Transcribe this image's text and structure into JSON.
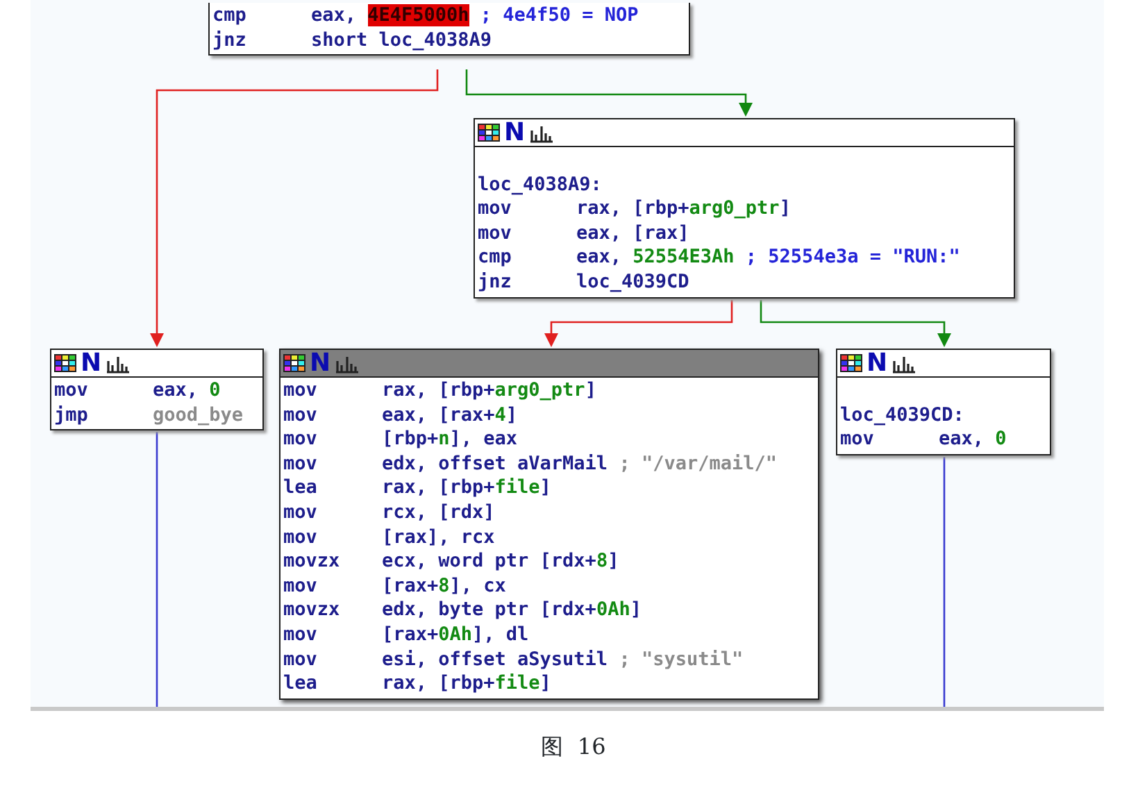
{
  "graph": {
    "nodes": [
      {
        "lines": [
          {
            "mnemonic": "cmp",
            "operand": [
              {
                "kind": "text",
                "text": "eax, "
              },
              {
                "kind": "highlight",
                "text": "4E4F5000h"
              }
            ],
            "comment": [
              {
                "kind": "comment",
                "text": "; 4e4f50 = NOP"
              }
            ]
          },
          {
            "mnemonic": "jnz",
            "operand": [
              {
                "kind": "text",
                "text": "short loc_4038A9"
              }
            ]
          }
        ]
      },
      {
        "selected": false,
        "header_mark": "N",
        "label": "loc_4038A9:",
        "lines": [
          {
            "mnemonic": "mov",
            "operand": [
              {
                "kind": "text",
                "text": "rax, [rbp+"
              },
              {
                "kind": "num",
                "text": "arg0_ptr"
              },
              {
                "kind": "text",
                "text": "]"
              }
            ]
          },
          {
            "mnemonic": "mov",
            "operand": [
              {
                "kind": "text",
                "text": "eax, [rax]"
              }
            ]
          },
          {
            "mnemonic": "cmp",
            "operand": [
              {
                "kind": "text",
                "text": "eax, "
              },
              {
                "kind": "num",
                "text": "52554E3Ah"
              }
            ],
            "comment": [
              {
                "kind": "comment",
                "text": "; 52554e3a = \"RUN:\""
              }
            ]
          },
          {
            "mnemonic": "jnz",
            "operand": [
              {
                "kind": "text",
                "text": "loc_4039CD"
              }
            ]
          }
        ]
      },
      {
        "selected": false,
        "header_mark": "N",
        "lines": [
          {
            "mnemonic": "mov",
            "operand": [
              {
                "kind": "text",
                "text": "eax, "
              },
              {
                "kind": "num",
                "text": "0"
              }
            ]
          },
          {
            "mnemonic": "jmp",
            "operand": [
              {
                "kind": "dim",
                "text": "good_bye"
              }
            ]
          }
        ]
      },
      {
        "selected": true,
        "header_mark": "N",
        "lines": [
          {
            "mnemonic": "mov",
            "operand": [
              {
                "kind": "text",
                "text": "rax, [rbp+"
              },
              {
                "kind": "num",
                "text": "arg0_ptr"
              },
              {
                "kind": "text",
                "text": "]"
              }
            ]
          },
          {
            "mnemonic": "mov",
            "operand": [
              {
                "kind": "text",
                "text": "eax, [rax+"
              },
              {
                "kind": "num",
                "text": "4"
              },
              {
                "kind": "text",
                "text": "]"
              }
            ]
          },
          {
            "mnemonic": "mov",
            "operand": [
              {
                "kind": "text",
                "text": "[rbp+"
              },
              {
                "kind": "num",
                "text": "n"
              },
              {
                "kind": "text",
                "text": "], eax"
              }
            ]
          },
          {
            "mnemonic": "mov",
            "operand": [
              {
                "kind": "text",
                "text": "edx, offset aVarMail"
              }
            ],
            "comment": [
              {
                "kind": "dim",
                "text": "; \"/var/mail/\""
              }
            ]
          },
          {
            "mnemonic": "lea",
            "operand": [
              {
                "kind": "text",
                "text": "rax, [rbp+"
              },
              {
                "kind": "num",
                "text": "file"
              },
              {
                "kind": "text",
                "text": "]"
              }
            ]
          },
          {
            "mnemonic": "mov",
            "operand": [
              {
                "kind": "text",
                "text": "rcx, [rdx]"
              }
            ]
          },
          {
            "mnemonic": "mov",
            "operand": [
              {
                "kind": "text",
                "text": "[rax], rcx"
              }
            ]
          },
          {
            "mnemonic": "movzx",
            "operand": [
              {
                "kind": "text",
                "text": "ecx, word ptr [rdx+"
              },
              {
                "kind": "num",
                "text": "8"
              },
              {
                "kind": "text",
                "text": "]"
              }
            ]
          },
          {
            "mnemonic": "mov",
            "operand": [
              {
                "kind": "text",
                "text": "[rax+"
              },
              {
                "kind": "num",
                "text": "8"
              },
              {
                "kind": "text",
                "text": "], cx"
              }
            ]
          },
          {
            "mnemonic": "movzx",
            "operand": [
              {
                "kind": "text",
                "text": "edx, byte ptr [rdx+"
              },
              {
                "kind": "num",
                "text": "0Ah"
              },
              {
                "kind": "text",
                "text": "]"
              }
            ]
          },
          {
            "mnemonic": "mov",
            "operand": [
              {
                "kind": "text",
                "text": "[rax+"
              },
              {
                "kind": "num",
                "text": "0Ah"
              },
              {
                "kind": "text",
                "text": "], dl"
              }
            ]
          },
          {
            "mnemonic": "mov",
            "operand": [
              {
                "kind": "text",
                "text": "esi, offset aSysutil"
              }
            ],
            "comment": [
              {
                "kind": "dim",
                "text": "; \"sysutil\""
              }
            ]
          },
          {
            "mnemonic": "lea",
            "operand": [
              {
                "kind": "text",
                "text": "rax, [rbp+"
              },
              {
                "kind": "num",
                "text": "file"
              },
              {
                "kind": "text",
                "text": "]"
              }
            ]
          }
        ]
      },
      {
        "selected": false,
        "header_mark": "N",
        "label": "loc_4039CD:",
        "lines": [
          {
            "mnemonic": "mov",
            "operand": [
              {
                "kind": "text",
                "text": "eax, "
              },
              {
                "kind": "num",
                "text": "0"
              }
            ]
          }
        ]
      }
    ]
  },
  "caption": "图  16"
}
